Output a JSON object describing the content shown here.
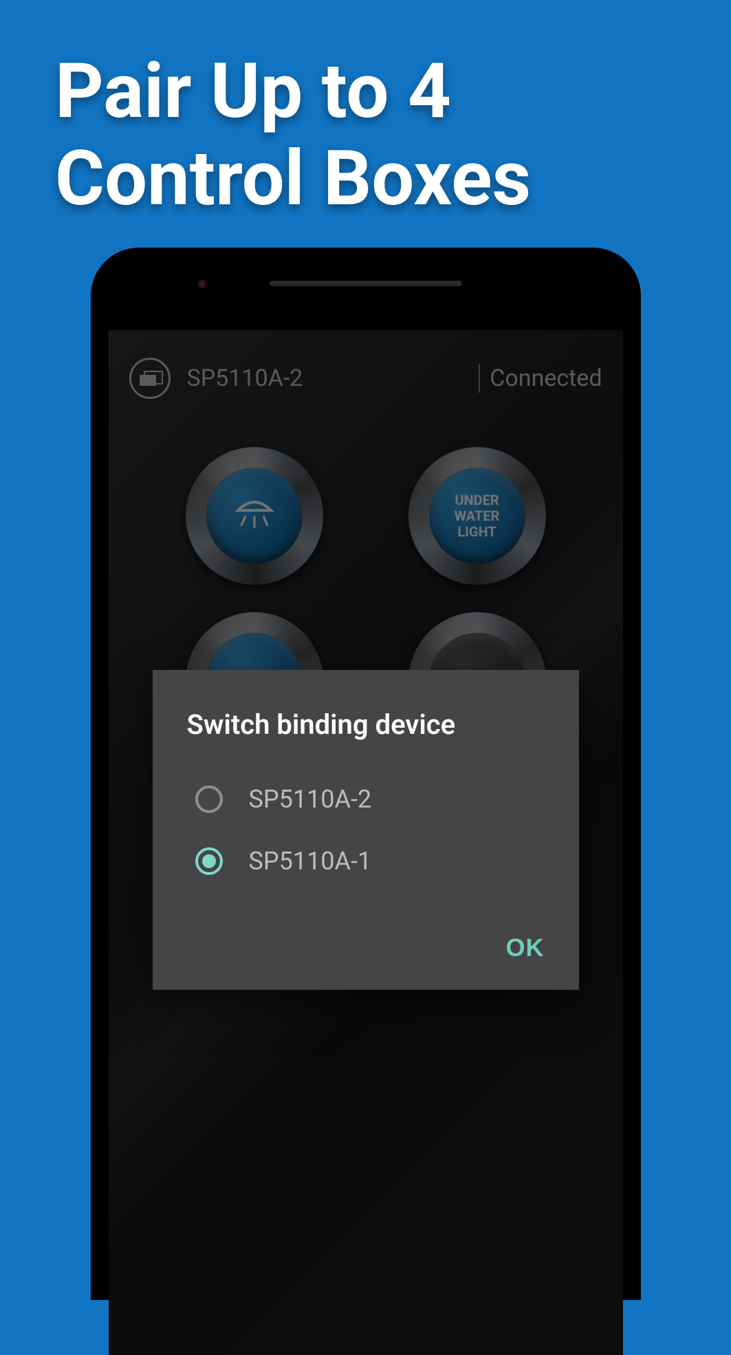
{
  "headline_line1": "Pair Up to 4",
  "headline_line2": "Control Boxes",
  "status": {
    "device_name": "SP5110A-2",
    "connection": "Connected"
  },
  "buttons": {
    "underwater_label": "UNDER\nWATER\nLIGHT"
  },
  "dialog": {
    "title": "Switch binding device",
    "options": [
      {
        "label": "SP5110A-2",
        "selected": false
      },
      {
        "label": "SP5110A-1",
        "selected": true
      }
    ],
    "ok_label": "OK"
  }
}
